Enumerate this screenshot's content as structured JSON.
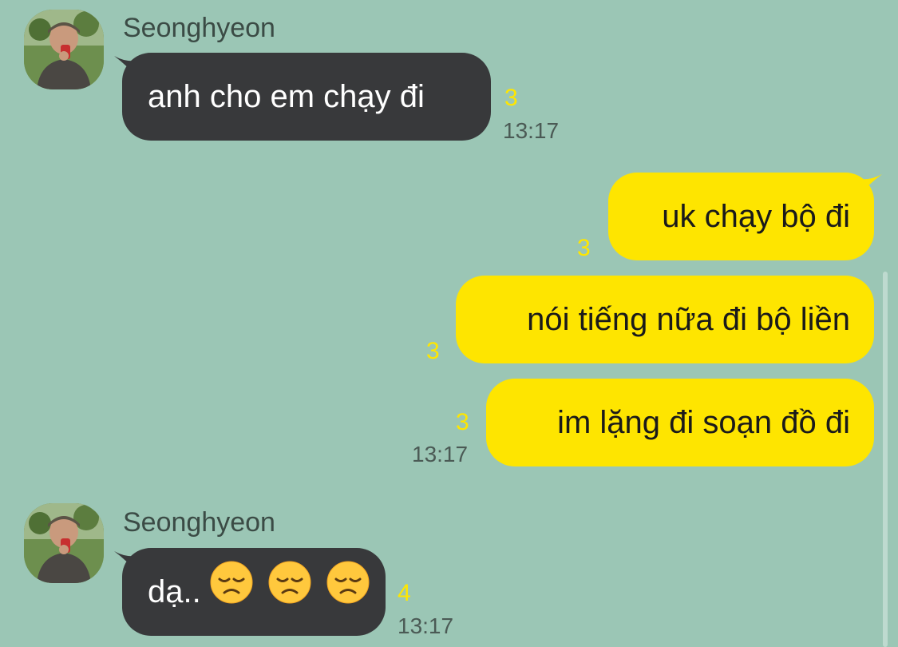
{
  "messages": [
    {
      "sender": "Seonghyeon",
      "text": "anh cho em chạy đi",
      "unread": "3",
      "time": "13:17"
    },
    {
      "text": "uk chạy bộ đi",
      "unread": "3"
    },
    {
      "text": "nói tiếng nữa đi bộ liền",
      "unread": "3"
    },
    {
      "text": "im lặng đi soạn đồ đi",
      "unread": "3",
      "time": "13:17"
    },
    {
      "sender": "Seonghyeon",
      "text": "dạ..",
      "emoji": [
        "disappointed-face-emoji",
        "disappointed-face-emoji",
        "disappointed-face-emoji"
      ],
      "unread": "4",
      "time": "13:17"
    }
  ],
  "colors": {
    "background": "#9bc6b5",
    "received_bubble": "#38393b",
    "sent_bubble": "#fee500",
    "unread_count": "#ffe600"
  }
}
